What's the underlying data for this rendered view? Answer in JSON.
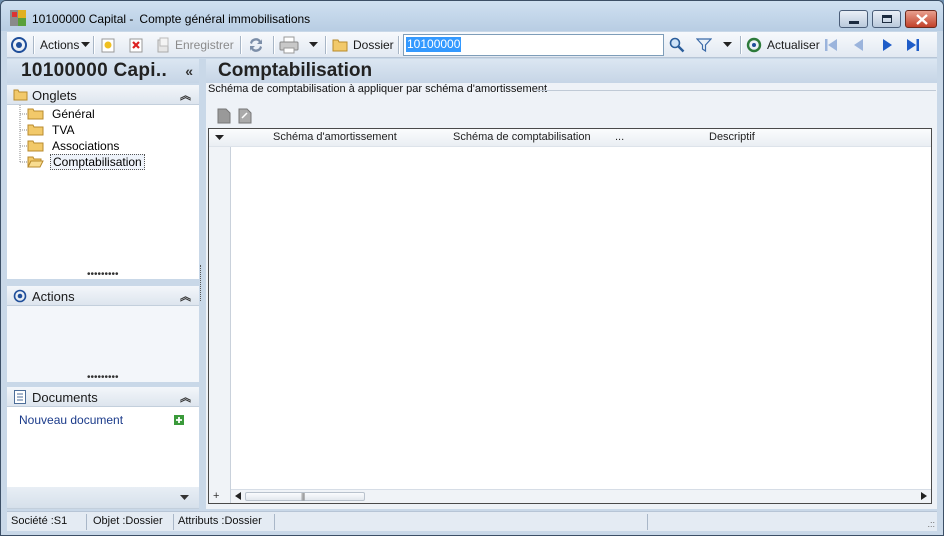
{
  "window": {
    "title_code": "10100000 Capital -",
    "title_desc": "Compte général immobilisations"
  },
  "toolbar": {
    "actions_label": "Actions",
    "save_label": "Enregistrer",
    "folder_label": "Dossier",
    "search_value": "10100000",
    "refresh_label": "Actualiser"
  },
  "left_panel": {
    "title": "10100000 Capi..",
    "collapse_glyph": "«",
    "tabs_section": {
      "label": "Onglets",
      "items": [
        {
          "label": "Général"
        },
        {
          "label": "TVA"
        },
        {
          "label": "Associations"
        },
        {
          "label": "Comptabilisation"
        }
      ]
    },
    "actions_section": {
      "label": "Actions"
    },
    "documents_section": {
      "label": "Documents",
      "new_document": "Nouveau document"
    }
  },
  "main": {
    "title": "Comptabilisation",
    "group_label": "Schéma de comptabilisation à appliquer par schéma d'amortissement",
    "columns": [
      "Schéma d'amortissement",
      "Schéma de comptabilisation",
      "...",
      "Descriptif"
    ],
    "add_glyph": "+"
  },
  "statusbar": {
    "societe": "Société :S1",
    "objet": "Objet :Dossier",
    "attributs": "Attributs :Dossier"
  },
  "colors": {
    "accent": "#1f4e9a",
    "frame": "#c9d8e8",
    "close_button": "#c2412a"
  }
}
